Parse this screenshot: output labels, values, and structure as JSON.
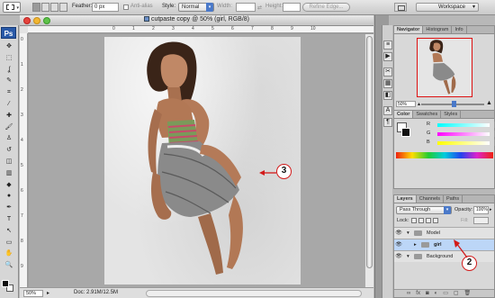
{
  "options_bar": {
    "feather_label": "Feather:",
    "feather_value": "0 px",
    "anti_alias_label": "Anti-alias",
    "style_label": "Style:",
    "style_value": "Normal",
    "width_label": "Width:",
    "height_label": "Height:",
    "refine_edge_label": "Refine Edge...",
    "workspace_label": "Workspace"
  },
  "toolbox": {
    "logo": "Ps",
    "tools": [
      "move",
      "marquee",
      "lasso",
      "quick-selection",
      "crop",
      "eyedropper",
      "healing-brush",
      "brush",
      "clone-stamp",
      "history-brush",
      "eraser",
      "gradient",
      "blur",
      "dodge",
      "pen",
      "type",
      "path-selection",
      "shape",
      "hand",
      "zoom"
    ],
    "tool_glyphs": [
      "✥",
      "⬚",
      "ʆ",
      "✎",
      "⌗",
      "⁄",
      "✚",
      "🖌",
      "♙",
      "↺",
      "◫",
      "▥",
      "◆",
      "●",
      "✒",
      "T",
      "↖",
      "▭",
      "✋",
      "🔍"
    ],
    "foreground_color": "#111111",
    "background_color": "#ffffff"
  },
  "document": {
    "title": "cutpaste copy @ 50% (girl, RGB/8)",
    "ruler_top_ticks": [
      "0",
      "1",
      "2",
      "3",
      "4",
      "5",
      "6",
      "7",
      "8",
      "9",
      "10"
    ],
    "ruler_left_ticks": [
      "0",
      "1",
      "2",
      "3",
      "4",
      "5",
      "6",
      "7",
      "8",
      "9"
    ],
    "zoom": "50%",
    "doc_size": "Doc: 2.91M/12.5M"
  },
  "callouts": [
    "3",
    "2"
  ],
  "navigator": {
    "tabs": [
      "Navigator",
      "Histogram",
      "Info"
    ],
    "zoom": "50%"
  },
  "color_panel": {
    "tabs": [
      "Color",
      "Swatches",
      "Styles"
    ],
    "channels": [
      {
        "label": "R",
        "value": "255",
        "gradient": "linear-gradient(90deg,#0ff,#fff)"
      },
      {
        "label": "G",
        "value": "255",
        "gradient": "linear-gradient(90deg,#f0f,#fff)"
      },
      {
        "label": "B",
        "value": "255",
        "gradient": "linear-gradient(90deg,#ff0,#fff)"
      }
    ]
  },
  "layers_panel": {
    "tabs": [
      "Layers",
      "Channels",
      "Paths"
    ],
    "blend_mode": "Pass Through",
    "opacity_label": "Opacity:",
    "opacity_value": "100%",
    "lock_label": "Lock:",
    "fill_label": "Fill:",
    "layers": [
      {
        "name": "Model",
        "type": "group",
        "indent": 0,
        "selected": false
      },
      {
        "name": "girl",
        "type": "group",
        "indent": 1,
        "selected": true
      },
      {
        "name": "Background",
        "type": "group",
        "indent": 0,
        "selected": false
      }
    ]
  },
  "colors": {
    "accent": "#4a79c9",
    "callout_red": "#d21a1a",
    "selected_layer": "#bcd6f7"
  }
}
